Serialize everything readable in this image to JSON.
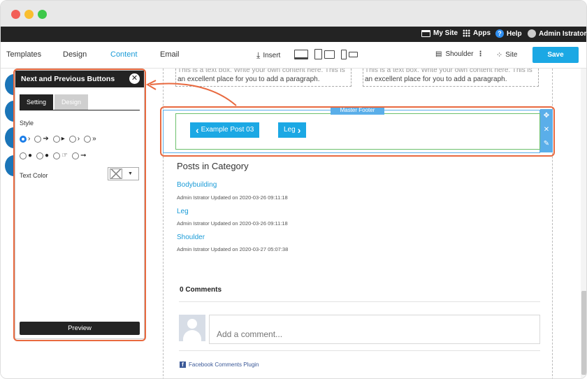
{
  "topbar": {
    "my_site": "My Site",
    "apps": "Apps",
    "help": "Help",
    "user": "Admin Istrator"
  },
  "nav": {
    "tabs": [
      "Templates",
      "Design",
      "Content",
      "Email"
    ],
    "active_tab": "Content",
    "insert": "Insert",
    "page": "Shoulder",
    "site": "Site",
    "save": "Save"
  },
  "content": {
    "para_left_line1": "This is a text box. Write your own content here. This is",
    "para_left_line2": "an excellent place for you to add a paragraph.",
    "para_right_line1": "This is a text box. Write your own content here. This is",
    "para_right_line2": "an excellent place for you to add a paragraph.",
    "master_footer_label": "Master Footer",
    "prev_button": "Example Post 03",
    "next_button": "Leg",
    "posts_title": "Posts in Category",
    "posts": [
      {
        "title": "Bodybuilding",
        "meta": "Admin Istrator Updated on 2020-03-26 09:11:18"
      },
      {
        "title": "Leg",
        "meta": "Admin Istrator Updated on 2020-03-26 09:11:18"
      },
      {
        "title": "Shoulder",
        "meta": "Admin Istrator Updated on 2020-03-27 05:07:38"
      }
    ],
    "comments_count": "0 Comments",
    "comment_placeholder": "Add a comment...",
    "fb_plugin": "Facebook Comments Plugin"
  },
  "panel": {
    "title": "Next and Previous Buttons",
    "tabs": [
      "Setting",
      "Design"
    ],
    "style_label": "Style",
    "style_options_row1": [
      "›",
      "➔",
      "▸",
      "›",
      "»"
    ],
    "style_options_row2": [
      "●",
      "●",
      "☞",
      "➞"
    ],
    "text_color_label": "Text Color",
    "preview": "Preview"
  },
  "colors": {
    "accent": "#1ba8e4",
    "highlight": "#e8693f",
    "dark": "#232323"
  }
}
